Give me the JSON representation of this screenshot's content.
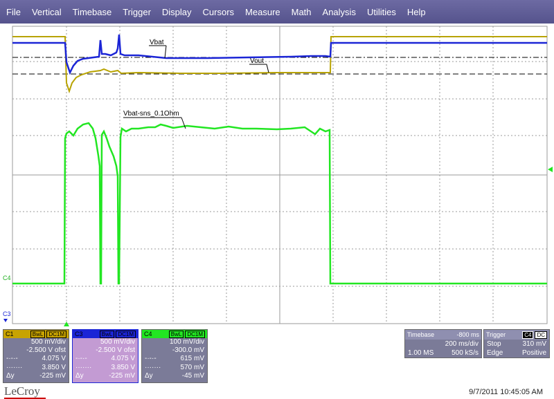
{
  "menu": [
    "File",
    "Vertical",
    "Timebase",
    "Trigger",
    "Display",
    "Cursors",
    "Measure",
    "Math",
    "Analysis",
    "Utilities",
    "Help"
  ],
  "colors": {
    "ch1": "#b8a300",
    "ch3": "#1b25d6",
    "ch4": "#22e622",
    "cursor": "#000000",
    "grid": "#9a9a9a"
  },
  "annotations": {
    "vbat": "Vbat",
    "vout": "Vout",
    "sns": "Vbat-sns_0.1Ohm"
  },
  "markers": {
    "c4": "C4",
    "c3": "C3"
  },
  "ch1": {
    "name": "C1",
    "badges": [
      "BwL",
      "DC1M"
    ],
    "scale": "500 mV/div",
    "offset": "-2.500 V ofst",
    "cursor1": "4.075 V",
    "cursor2": "3.850 V",
    "delta": "-225 mV",
    "delta_label": "Δy"
  },
  "ch3": {
    "name": "C3",
    "badges": [
      "BwL",
      "DC1M"
    ],
    "scale": "500 mV/div",
    "offset": "-2.500 V ofst",
    "cursor1": "4.075 V",
    "cursor2": "3.850 V",
    "delta": "-225 mV",
    "delta_label": "Δy"
  },
  "ch4": {
    "name": "C4",
    "badges": [
      "BwL",
      "DC1M"
    ],
    "scale": "100 mV/div",
    "offset": "-300.0 mV",
    "cursor1": "615 mV",
    "cursor2": "570 mV",
    "delta": "-45 mV",
    "delta_label": "Δy"
  },
  "timebase": {
    "title": "Timebase",
    "delay": "-800 ms",
    "scale": "200 ms/div",
    "samples": "1.00 MS",
    "rate": "500 kS/s"
  },
  "trigger": {
    "title": "Trigger",
    "source": "C4",
    "coupling": "DC",
    "mode": "Stop",
    "level": "310 mV",
    "type": "Edge",
    "slope": "Positive"
  },
  "brand": "LeCroy",
  "datetime": "9/7/2011 10:45:05 AM"
}
